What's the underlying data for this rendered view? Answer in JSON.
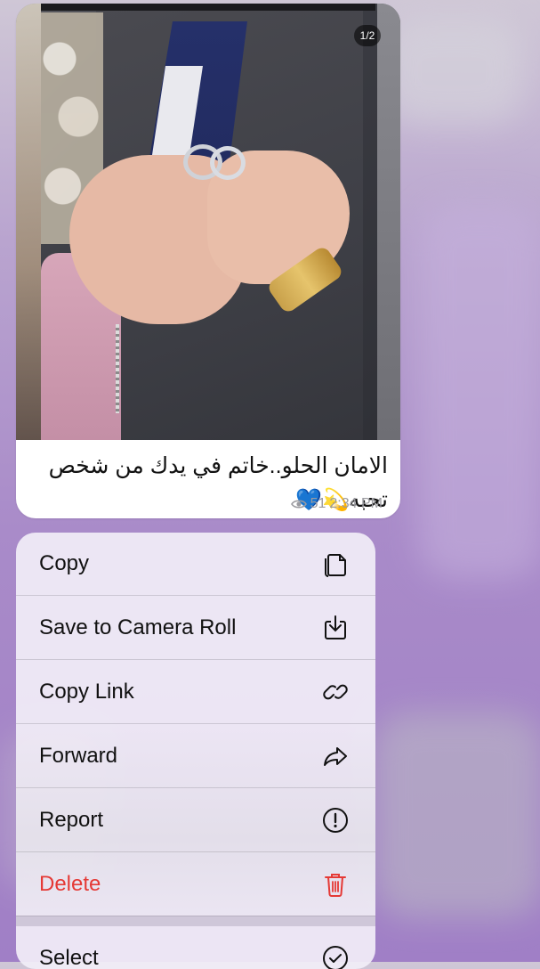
{
  "message": {
    "media_counter": "1/2",
    "caption": "الامان الحلو..خاتم في يدك من شخص تحبه",
    "caption_emojis": "💫💙",
    "views": "51",
    "time": "2:34 PM"
  },
  "context_menu": {
    "items": [
      {
        "label": "Copy",
        "icon": "copy-icon"
      },
      {
        "label": "Save to Camera Roll",
        "icon": "save-download-icon"
      },
      {
        "label": "Copy Link",
        "icon": "link-icon"
      },
      {
        "label": "Forward",
        "icon": "forward-arrow-icon"
      },
      {
        "label": "Report",
        "icon": "exclamation-circle-icon"
      },
      {
        "label": "Delete",
        "icon": "trash-icon"
      },
      {
        "label": "Select",
        "icon": "checkmark-circle-icon"
      }
    ],
    "destructive_color": "#e53935"
  }
}
